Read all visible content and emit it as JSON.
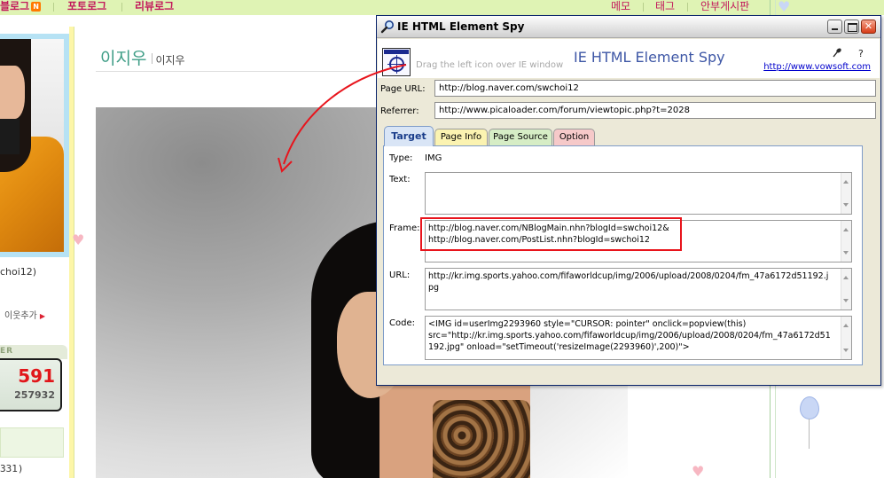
{
  "blog_nav": {
    "left_items": [
      "블로그",
      "포토로그",
      "리뷰로그"
    ],
    "new_badge": "N",
    "right_items": [
      "메모",
      "태그",
      "안부게시판"
    ]
  },
  "sidebar": {
    "profile_name": "choi12)",
    "neighbor_add": "이웃추가",
    "counter_label": "ER",
    "counter_today": "591",
    "counter_total": "257932",
    "bottom_text": "331)"
  },
  "post": {
    "title": "이지우",
    "subtitle": "이지우"
  },
  "spy_window": {
    "title": "IE HTML Element Spy",
    "drag_hint": "Drag the left icon over IE window",
    "app_title": "IE HTML Element Spy",
    "help_label": "?",
    "site_link": "http://www.vowsoft.com",
    "page_url_label": "Page URL:",
    "page_url": "http://blog.naver.com/swchoi12",
    "referrer_label": "Referrer:",
    "referrer": "http://www.picaloader.com/forum/viewtopic.php?t=2028",
    "tabs": [
      {
        "label": "Target",
        "active": true
      },
      {
        "label": "Page Info",
        "active": false
      },
      {
        "label": "Page Source",
        "active": false
      },
      {
        "label": "Option",
        "active": false
      }
    ],
    "target": {
      "type_label": "Type:",
      "type_value": "IMG",
      "text_label": "Text:",
      "text_value": "",
      "frame_label": "Frame:",
      "frame_lines": [
        "http://blog.naver.com/NBlogMain.nhn?blogId=swchoi12&",
        "http://blog.naver.com/PostList.nhn?blogId=swchoi12"
      ],
      "url_label": "URL:",
      "url_lines": [
        "http://kr.img.sports.yahoo.com/fifaworldcup/img/2006/upload/2008/0204/fm_47a6172d51192.j",
        "pg"
      ],
      "code_label": "Code:",
      "code_lines": [
        "<IMG id=userImg2293960 style=\"CURSOR: pointer\" onclick=popview(this)",
        "src=\"http://kr.img.sports.yahoo.com/fifaworldcup/img/2006/upload/2008/0204/fm_47a6172d51",
        "192.jpg\" onload=\"setTimeout('resizeImage(2293960)',200)\">"
      ]
    }
  },
  "colors": {
    "highlight_box": "#e8141c",
    "arrow": "#e8141c",
    "title_accent": "#3e57a6",
    "counter_red": "#e1161a"
  }
}
